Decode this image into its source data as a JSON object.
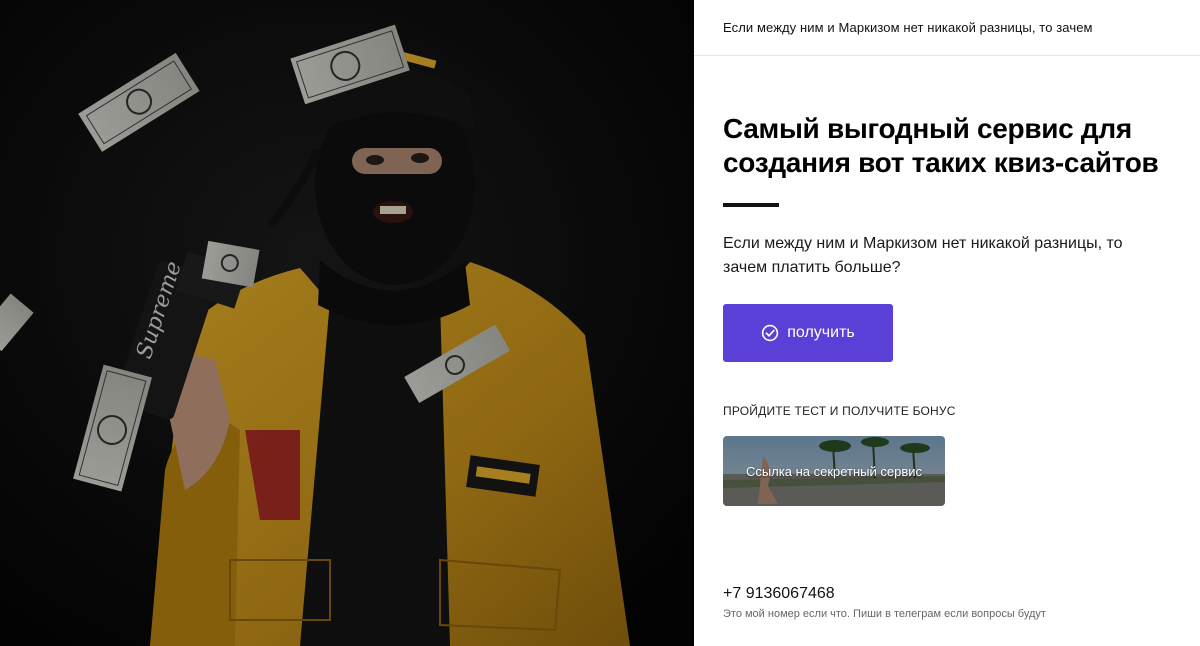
{
  "colors": {
    "accent": "#5b3fd6",
    "jacket": "#e0a821",
    "background_dark": "#0b0b0b"
  },
  "hero": {
    "image_icon": "masked-man-with-money-photo"
  },
  "header": {
    "text": "Если между ним и Маркизом нет никакой разницы, то зачем"
  },
  "main": {
    "title": "Самый выгодный сервис для создания вот таких квиз-сайтов",
    "subtitle": "Если между ним и Маркизом нет никакой разницы, то зачем платить больше?",
    "cta_label": "получить",
    "cta_icon": "check-circle-icon"
  },
  "bonus": {
    "label": "ПРОЙДИТЕ ТЕСТ И ПОЛУЧИТЕ БОНУС",
    "link_label": "Ссылка на секретный сервис"
  },
  "contact": {
    "phone": "+7 9136067468",
    "note": "Это мой номер если что. Пиши в телеграм если вопросы будут"
  }
}
